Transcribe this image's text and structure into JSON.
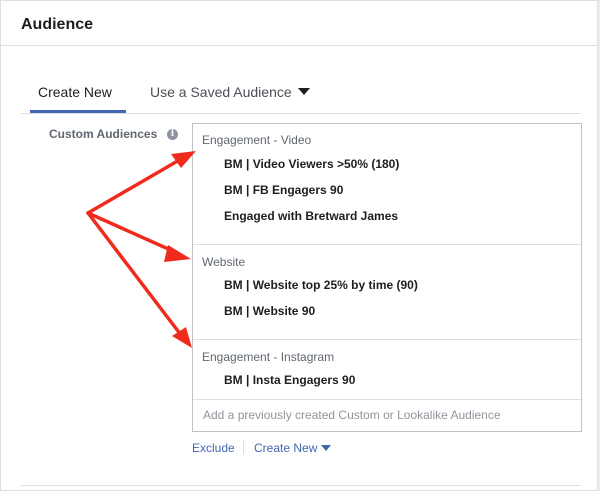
{
  "header": {
    "title": "Audience"
  },
  "tabs": [
    {
      "label": "Create New",
      "active": true
    },
    {
      "label": "Use a Saved Audience",
      "active": false
    }
  ],
  "custom_audiences": {
    "label": "Custom Audiences",
    "info_icon": "info-icon",
    "groups": [
      {
        "title": "Engagement - Video",
        "items": [
          "BM | Video Viewers >50% (180)",
          "BM | FB Engagers 90",
          "Engaged with Bretward James"
        ]
      },
      {
        "title": "Website",
        "items": [
          "BM | Website top 25% by time (90)",
          "BM | Website 90"
        ]
      },
      {
        "title": "Engagement - Instagram",
        "items": [
          "BM | Insta Engagers 90"
        ]
      }
    ],
    "input_placeholder": "Add a previously created Custom or Lookalike Audience"
  },
  "links": {
    "exclude": "Exclude",
    "create_new": "Create New"
  },
  "colors": {
    "accent": "#4267b2",
    "arrow": "#f02b1d",
    "border": "#dddfe2"
  }
}
